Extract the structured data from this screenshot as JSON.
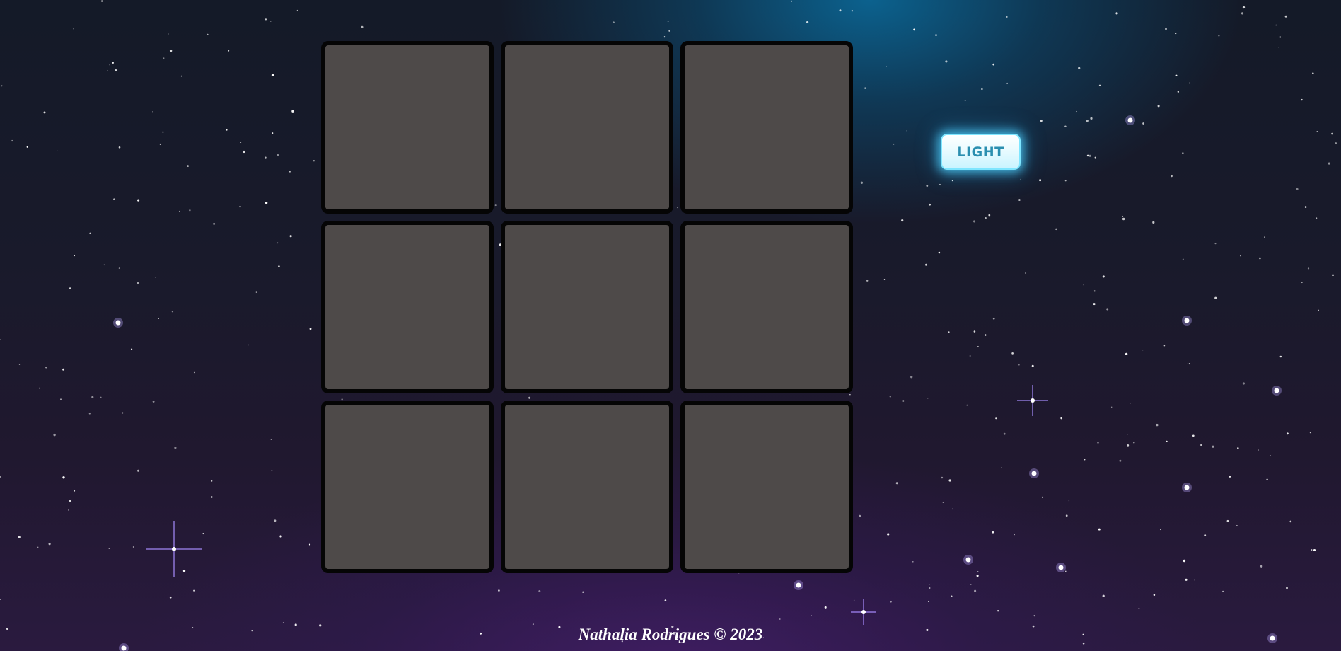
{
  "theme_toggle": {
    "label": "LIGHT"
  },
  "board": {
    "cells": [
      "",
      "",
      "",
      "",
      "",
      "",
      "",
      "",
      ""
    ]
  },
  "footer": {
    "credit": "Nathalia Rodrigues © 2023"
  },
  "colors": {
    "cell_fill": "#4e4a49",
    "cell_border": "#050505",
    "button_text": "#2a8fb0",
    "button_glow": "#50d2ff"
  }
}
